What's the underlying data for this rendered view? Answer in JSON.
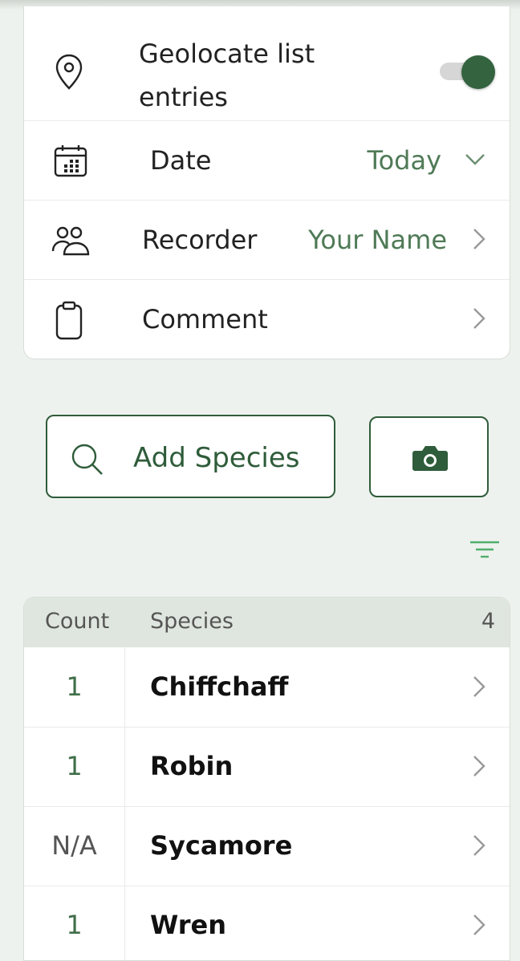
{
  "settings": {
    "geolocate": {
      "label": "Geolocate list entries",
      "line1": "Geolocate list",
      "line2": "entries",
      "enabled": true
    },
    "date": {
      "label": "Date",
      "value": "Today"
    },
    "recorder": {
      "label": "Recorder",
      "value": "Your Name"
    },
    "comment": {
      "label": "Comment"
    }
  },
  "actions": {
    "add_species_label": "Add Species"
  },
  "table": {
    "headers": {
      "count": "Count",
      "species": "Species",
      "total": "4"
    },
    "rows": [
      {
        "count": "1",
        "species": "Chiffchaff"
      },
      {
        "count": "1",
        "species": "Robin"
      },
      {
        "count": "N/A",
        "species": "Sycamore"
      },
      {
        "count": "1",
        "species": "Wren"
      }
    ]
  },
  "colors": {
    "accent": "#2f5c3a",
    "value_text": "#4f7a56",
    "header_bg": "#dfe6df",
    "background": "#eef2ee"
  },
  "icons": [
    "location-pin-icon",
    "calendar-icon",
    "people-icon",
    "clipboard-icon",
    "chevron-down-icon",
    "chevron-right-icon",
    "search-icon",
    "camera-icon",
    "filter-icon"
  ]
}
